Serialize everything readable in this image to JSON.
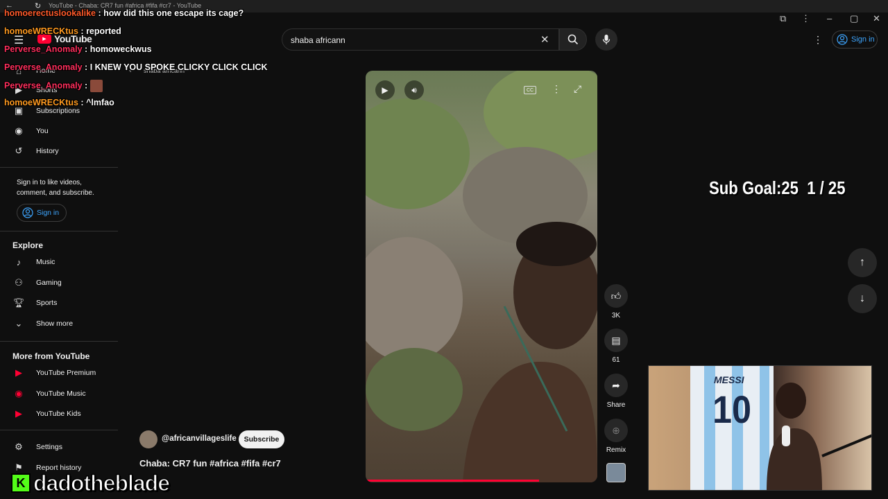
{
  "window": {
    "title": "YouTube - Chaba: CR7 fun #africa #fifa #cr7 - YouTube"
  },
  "header": {
    "logo_text": "YouTube",
    "sign_in": "Sign in"
  },
  "search": {
    "query": "shaba africann",
    "back_label": "shaba africann"
  },
  "sidebar": {
    "items": [
      {
        "label": "Home",
        "icon": "home-icon"
      },
      {
        "label": "Shorts",
        "icon": "shorts-icon"
      },
      {
        "label": "Subscriptions",
        "icon": "subscriptions-icon"
      },
      {
        "label": "You",
        "icon": "you-icon"
      },
      {
        "label": "History",
        "icon": "history-icon"
      }
    ],
    "signin_prompt": "Sign in to like videos, comment, and subscribe.",
    "signin_button": "Sign in",
    "explore_heading": "Explore",
    "explore": [
      {
        "label": "Music",
        "icon": "music-icon"
      },
      {
        "label": "Gaming",
        "icon": "gaming-icon"
      },
      {
        "label": "Sports",
        "icon": "sports-icon"
      },
      {
        "label": "Show more",
        "icon": "chevron-down-icon"
      }
    ],
    "more_heading": "More from YouTube",
    "more": [
      {
        "label": "YouTube Premium",
        "icon": "youtube-premium-icon"
      },
      {
        "label": "YouTube Music",
        "icon": "youtube-music-icon"
      },
      {
        "label": "YouTube Kids",
        "icon": "youtube-kids-icon"
      }
    ],
    "footer": [
      {
        "label": "Settings",
        "icon": "settings-icon"
      },
      {
        "label": "Report history",
        "icon": "flag-icon"
      }
    ]
  },
  "chat": [
    {
      "user": "homoerectuslookalike",
      "msg": "how did this one escape its cage?"
    },
    {
      "user": "homoeWRECKtus",
      "msg": "reported"
    },
    {
      "user": "Perverse_Anomaly",
      "msg": "homoweckwus"
    },
    {
      "user": "Perverse_Anomaly",
      "msg": "I KNEW YOU SPOKE CLICKY CLICK CLICK"
    },
    {
      "user": "Perverse_Anomaly",
      "msg": ""
    },
    {
      "user": "homoeWRECKtus",
      "msg": "^lmfao"
    }
  ],
  "short": {
    "channel": "@africanvillageslife",
    "subscribe": "Subscribe",
    "title": "Chaba: CR7 fun #africa #fifa #cr7",
    "likes": "3K",
    "comments": "61",
    "share": "Share",
    "remix": "Remix",
    "cc": "CC"
  },
  "stream": {
    "sub_goal": "Sub Goal:25  1 / 25",
    "streamer": "dadotheblade",
    "jersey_name": "MESSI",
    "jersey_number": "10"
  },
  "colors": {
    "accent": "#3ea6ff",
    "youtube_red": "#ff0033",
    "background": "#0f0f0f"
  }
}
